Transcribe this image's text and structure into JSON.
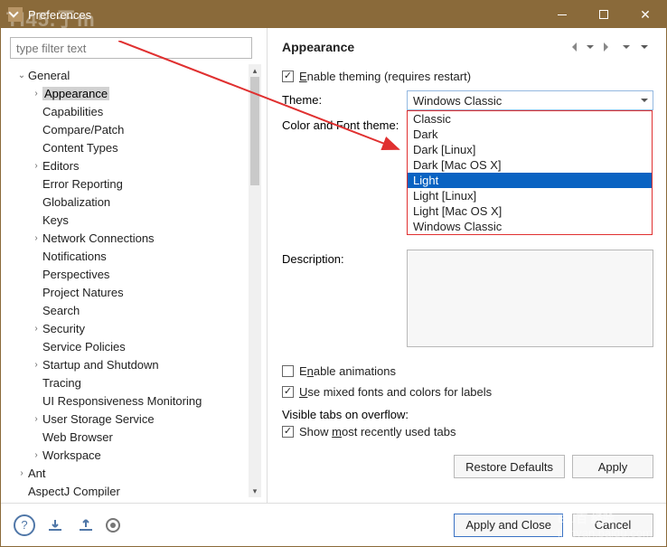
{
  "titlebar": {
    "title": "Preferences",
    "watermark": "TI45.于m"
  },
  "sidebar": {
    "filter_placeholder": "type filter text",
    "items": [
      {
        "label": "General",
        "depth": 0,
        "exp": "open"
      },
      {
        "label": "Appearance",
        "depth": 1,
        "exp": "closed",
        "selected": true
      },
      {
        "label": "Capabilities",
        "depth": 1
      },
      {
        "label": "Compare/Patch",
        "depth": 1
      },
      {
        "label": "Content Types",
        "depth": 1
      },
      {
        "label": "Editors",
        "depth": 1,
        "exp": "closed"
      },
      {
        "label": "Error Reporting",
        "depth": 1
      },
      {
        "label": "Globalization",
        "depth": 1
      },
      {
        "label": "Keys",
        "depth": 1
      },
      {
        "label": "Network Connections",
        "depth": 1,
        "exp": "closed"
      },
      {
        "label": "Notifications",
        "depth": 1
      },
      {
        "label": "Perspectives",
        "depth": 1
      },
      {
        "label": "Project Natures",
        "depth": 1
      },
      {
        "label": "Search",
        "depth": 1
      },
      {
        "label": "Security",
        "depth": 1,
        "exp": "closed"
      },
      {
        "label": "Service Policies",
        "depth": 1
      },
      {
        "label": "Startup and Shutdown",
        "depth": 1,
        "exp": "closed"
      },
      {
        "label": "Tracing",
        "depth": 1
      },
      {
        "label": "UI Responsiveness Monitoring",
        "depth": 1
      },
      {
        "label": "User Storage Service",
        "depth": 1,
        "exp": "closed"
      },
      {
        "label": "Web Browser",
        "depth": 1
      },
      {
        "label": "Workspace",
        "depth": 1,
        "exp": "closed"
      },
      {
        "label": "Ant",
        "depth": 0,
        "exp": "closed"
      },
      {
        "label": "AspectJ Compiler",
        "depth": 0
      }
    ]
  },
  "main": {
    "heading": "Appearance",
    "enable_theming": {
      "label_pre": "Enable theming (requires restart)",
      "mn": "E",
      "checked": true
    },
    "theme_label": {
      "text": "Theme:",
      "mn": "T"
    },
    "theme_value": "Windows Classic",
    "color_font_label": "Color and Font theme:",
    "dropdown_options": [
      "Classic",
      "Dark",
      "Dark [Linux]",
      "Dark [Mac OS X]",
      "Light",
      "Light [Linux]",
      "Light [Mac OS X]",
      "Windows Classic"
    ],
    "dropdown_selected": "Light",
    "description_label": "Description:",
    "enable_animations": {
      "label": "Enable animations",
      "mn": "n",
      "checked": false
    },
    "mixed_fonts": {
      "label": "Use mixed fonts and colors for labels",
      "mn": "U",
      "checked": true
    },
    "visible_tabs_heading": "Visible tabs on overflow:",
    "show_mru": {
      "label": "Show most recently used tabs",
      "mn": "m",
      "checked": true
    },
    "restore_defaults": "Restore Defaults",
    "apply": "Apply"
  },
  "footer": {
    "apply_close": "Apply and Close",
    "cancel": "Cancel"
  },
  "baidu_watermark": "Bai百 经验\njingyan.baidu.com"
}
